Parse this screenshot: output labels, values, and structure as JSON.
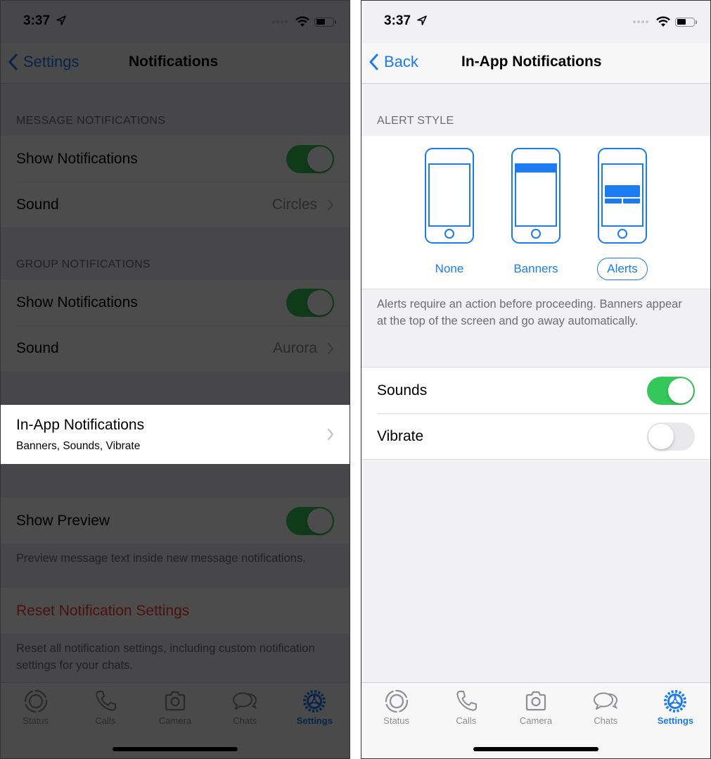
{
  "colors": {
    "accent": "#1a7cf0",
    "toggle_on": "#34c759",
    "toggle_off": "#e9e9eb",
    "destructive": "#ff3b30",
    "secondary_text": "#6d6d72"
  },
  "left_screen": {
    "status_bar": {
      "time": "3:37"
    },
    "nav": {
      "back_label": "Settings",
      "title": "Notifications"
    },
    "message_notifications": {
      "header": "MESSAGE NOTIFICATIONS",
      "show_notifications": {
        "label": "Show Notifications",
        "on": true
      },
      "sound": {
        "label": "Sound",
        "value": "Circles"
      }
    },
    "group_notifications": {
      "header": "GROUP NOTIFICATIONS",
      "show_notifications": {
        "label": "Show Notifications",
        "on": true
      },
      "sound": {
        "label": "Sound",
        "value": "Aurora"
      }
    },
    "in_app": {
      "title": "In-App Notifications",
      "subtitle": "Banners, Sounds, Vibrate"
    },
    "show_preview": {
      "label": "Show Preview",
      "on": true,
      "footnote": "Preview message text inside new message notifications."
    },
    "reset": {
      "label": "Reset Notification Settings",
      "footnote": "Reset all notification settings, including custom notification settings for your chats."
    },
    "overlay": "dimmed"
  },
  "right_screen": {
    "status_bar": {
      "time": "3:37"
    },
    "nav": {
      "back_label": "Back",
      "title": "In-App Notifications"
    },
    "alert_style": {
      "header": "ALERT STYLE",
      "options": [
        {
          "label": "None",
          "icon": "phone-none-icon"
        },
        {
          "label": "Banners",
          "icon": "phone-banner-icon"
        },
        {
          "label": "Alerts",
          "icon": "phone-alert-icon"
        }
      ],
      "selected": "Alerts",
      "footnote": "Alerts require an action before proceeding. Banners appear at the top of the screen and go away automatically."
    },
    "sounds": {
      "label": "Sounds",
      "on": true
    },
    "vibrate": {
      "label": "Vibrate",
      "on": false
    }
  },
  "tab_bar": {
    "tabs": [
      {
        "label": "Status",
        "icon": "status-icon"
      },
      {
        "label": "Calls",
        "icon": "phone-icon"
      },
      {
        "label": "Camera",
        "icon": "camera-icon"
      },
      {
        "label": "Chats",
        "icon": "chats-icon"
      },
      {
        "label": "Settings",
        "icon": "settings-gear-icon"
      }
    ],
    "active": "Settings"
  }
}
